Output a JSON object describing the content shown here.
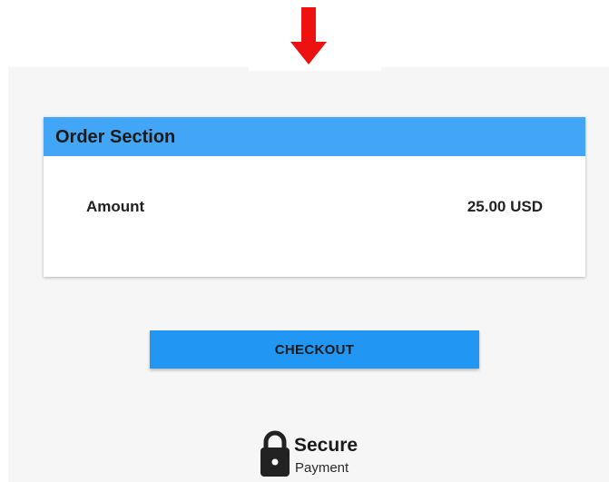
{
  "order": {
    "title": "Order Section",
    "amount_label": "Amount",
    "amount_value": "25.00 USD"
  },
  "checkout_label": "CHECKOUT",
  "secure": {
    "title": "Secure",
    "subtitle": "Payment"
  },
  "icons": {
    "pointer": "down-arrow-icon",
    "secure": "lock-icon"
  },
  "colors": {
    "arrow": "#ee1111",
    "header": "#42a5f5",
    "button": "#2196f3",
    "panel": "#f6f6f6"
  }
}
